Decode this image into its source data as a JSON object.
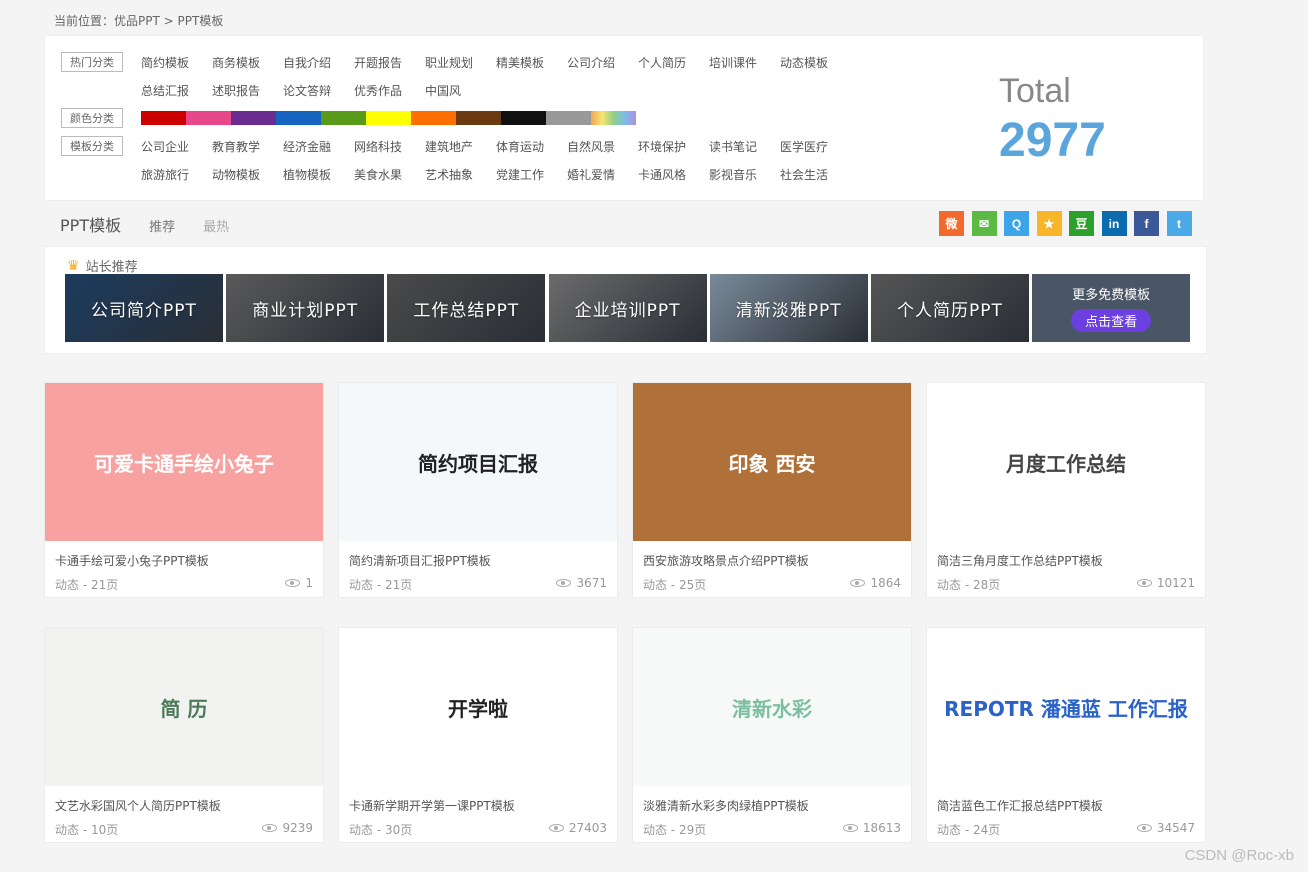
{
  "breadcrumb": {
    "prefix": "当前位置：",
    "home": "优品PPT",
    "sep": ">",
    "current": "PPT模板"
  },
  "filters": {
    "hot_label": "热门分类",
    "hot_row1": [
      "简约模板",
      "商务模板",
      "自我介绍",
      "开题报告",
      "职业规划",
      "精美模板",
      "公司介绍",
      "个人简历",
      "培训课件",
      "动态模板"
    ],
    "hot_row2": [
      "总结汇报",
      "述职报告",
      "论文答辩",
      "优秀作品",
      "中国风"
    ],
    "color_label": "颜色分类",
    "colors": [
      "#cc0000",
      "#e8488a",
      "#6a2c91",
      "#1565c0",
      "#5a9a1a",
      "#ffff00",
      "#ff6f00",
      "#6b3a10",
      "#111111",
      "#999999",
      "rainbow"
    ],
    "template_label": "模板分类",
    "tpl_row1": [
      "公司企业",
      "教育教学",
      "经济金融",
      "网络科技",
      "建筑地产",
      "体育运动",
      "自然风景",
      "环境保护",
      "读书笔记",
      "医学医疗"
    ],
    "tpl_row2": [
      "旅游旅行",
      "动物模板",
      "植物模板",
      "美食水果",
      "艺术抽象",
      "党建工作",
      "婚礼爱情",
      "卡通风格",
      "影视音乐",
      "社会生活"
    ]
  },
  "total": {
    "label": "Total",
    "value": "2977"
  },
  "tabs": {
    "main": "PPT模板",
    "recommend": "推荐",
    "hot": "最热"
  },
  "share": [
    {
      "icon": "weibo-icon",
      "glyph": "微",
      "color": "#f26a2c"
    },
    {
      "icon": "wechat-icon",
      "glyph": "✉",
      "color": "#5bb944"
    },
    {
      "icon": "qq-icon",
      "glyph": "Q",
      "color": "#3ea4e8"
    },
    {
      "icon": "qzone-icon",
      "glyph": "★",
      "color": "#f7b52a"
    },
    {
      "icon": "douban-icon",
      "glyph": "豆",
      "color": "#2ba02b"
    },
    {
      "icon": "linkedin-icon",
      "glyph": "in",
      "color": "#0a6cad"
    },
    {
      "icon": "facebook-icon",
      "glyph": "f",
      "color": "#3b5998"
    },
    {
      "icon": "twitter-icon",
      "glyph": "t",
      "color": "#4aa9e6"
    }
  ],
  "recommend": {
    "title": "站长推荐",
    "tiles": [
      "公司简介PPT",
      "商业计划PPT",
      "工作总结PPT",
      "企业培训PPT",
      "清新淡雅PPT",
      "个人简历PPT"
    ],
    "tile_colors": [
      "#1c3b5e",
      "#5a5a5a",
      "#4a4a4a",
      "#6b6b6b",
      "#7a8a9a",
      "#555555"
    ],
    "more_text": "更多免费模板",
    "more_button": "点击查看"
  },
  "cards": [
    {
      "title": "卡通手绘可爱小兔子PPT模板",
      "meta": "动态 - 21页",
      "views": "1",
      "thumb_text": "可爱卡通手绘小兔子",
      "thumb_color": "#f7a1a0",
      "text_color": "#ffffff"
    },
    {
      "title": "简约清新项目汇报PPT模板",
      "meta": "动态 - 21页",
      "views": "3671",
      "thumb_text": "简约项目汇报",
      "thumb_color": "#f5f8fb",
      "text_color": "#222222"
    },
    {
      "title": "西安旅游攻略景点介绍PPT模板",
      "meta": "动态 - 25页",
      "views": "1864",
      "thumb_text": "印象 西安",
      "thumb_color": "#b0703a",
      "text_color": "#ffffff"
    },
    {
      "title": "简洁三角月度工作总结PPT模板",
      "meta": "动态 - 28页",
      "views": "10121",
      "thumb_text": "月度工作总结",
      "thumb_color": "#ffffff",
      "text_color": "#444444"
    },
    {
      "title": "文艺水彩国风个人简历PPT模板",
      "meta": "动态 - 10页",
      "views": "9239",
      "thumb_text": "简 历",
      "thumb_color": "#f2f2f0",
      "text_color": "#4a7a5a"
    },
    {
      "title": "卡通新学期开学第一课PPT模板",
      "meta": "动态 - 30页",
      "views": "27403",
      "thumb_text": "开学啦",
      "thumb_color": "#ffffff",
      "text_color": "#222222"
    },
    {
      "title": "淡雅清新水彩多肉绿植PPT模板",
      "meta": "动态 - 29页",
      "views": "18613",
      "thumb_text": "清新水彩",
      "thumb_color": "#f6f9f8",
      "text_color": "#7cbfa0"
    },
    {
      "title": "简洁蓝色工作汇报总结PPT模板",
      "meta": "动态 - 24页",
      "views": "34547",
      "thumb_text": "REPOTR 潘通蓝 工作汇报",
      "thumb_color": "#ffffff",
      "text_color": "#2a62c8"
    }
  ],
  "watermark": "CSDN @Roc-xb"
}
